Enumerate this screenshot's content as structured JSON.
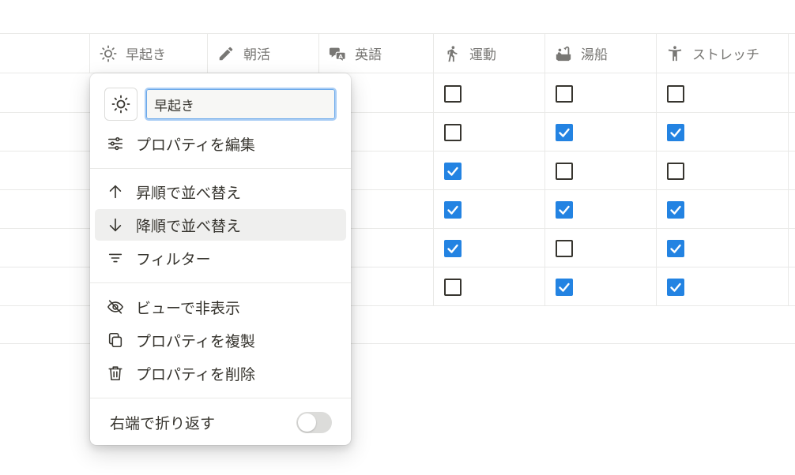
{
  "columns": [
    {
      "label": "早起き",
      "icon": "sun-icon"
    },
    {
      "label": "朝活",
      "icon": "pencil-icon"
    },
    {
      "label": "英語",
      "icon": "translate-icon"
    },
    {
      "label": "運動",
      "icon": "running-icon"
    },
    {
      "label": "湯船",
      "icon": "bathtub-icon"
    },
    {
      "label": "ストレッチ",
      "icon": "stretch-icon"
    }
  ],
  "rows": [
    {
      "運動": false,
      "湯船": false,
      "ストレッチ": false
    },
    {
      "運動": false,
      "湯船": true,
      "ストレッチ": true
    },
    {
      "運動": true,
      "湯船": false,
      "ストレッチ": false
    },
    {
      "運動": true,
      "湯船": true,
      "ストレッチ": true
    },
    {
      "運動": true,
      "湯船": false,
      "ストレッチ": true
    },
    {
      "運動": false,
      "湯船": true,
      "ストレッチ": true
    }
  ],
  "menu": {
    "property_icon": "sun-icon",
    "property_name": "早起き",
    "items": {
      "edit": "プロパティを編集",
      "sort_asc": "昇順で並べ替え",
      "sort_desc": "降順で並べ替え",
      "filter": "フィルター",
      "hide": "ビューで非表示",
      "duplicate": "プロパティを複製",
      "delete": "プロパティを削除"
    },
    "wrap_label": "右端で折り返す",
    "wrap_enabled": false
  },
  "colors": {
    "accent": "#2383e2",
    "text": "#37352f",
    "muted": "#787774",
    "border": "#e9e9e7"
  }
}
